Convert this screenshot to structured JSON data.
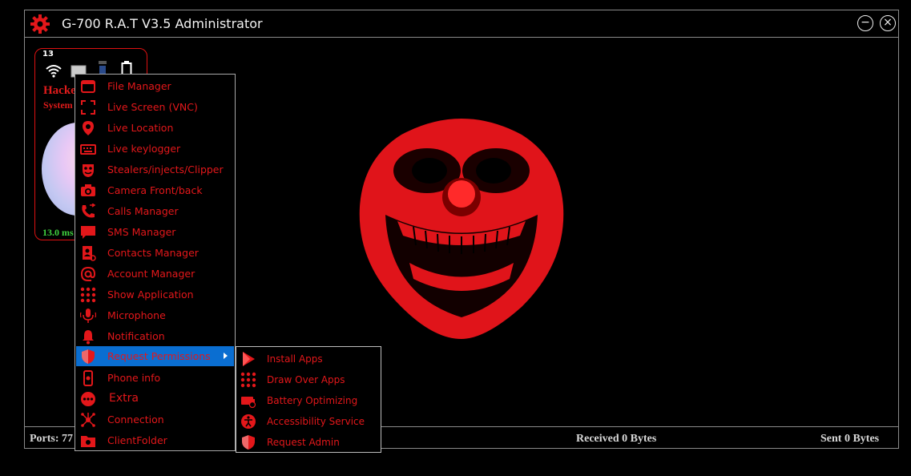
{
  "window": {
    "title": "G-700 R.A.T V3.5 Administrator",
    "minimize_glyph": "−",
    "close_glyph": "×"
  },
  "client": {
    "number": "13",
    "name": "Hacke",
    "system": "System",
    "ping": "13.0 ms"
  },
  "context_menu": {
    "items": [
      {
        "label": "File Manager",
        "icon": "file-manager-icon"
      },
      {
        "label": "Live Screen (VNC)",
        "icon": "fullscreen-icon"
      },
      {
        "label": "Live Location",
        "icon": "location-pin-icon"
      },
      {
        "label": "Live keylogger",
        "icon": "keyboard-icon"
      },
      {
        "label": "Stealers/injects/Clipper",
        "icon": "mask-icon"
      },
      {
        "label": "Camera  Front/back",
        "icon": "camera-icon"
      },
      {
        "label": "Calls Manager",
        "icon": "phone-call-icon"
      },
      {
        "label": "SMS Manager",
        "icon": "sms-icon"
      },
      {
        "label": "Contacts Manager",
        "icon": "contacts-icon"
      },
      {
        "label": "Account Manager",
        "icon": "at-sign-icon"
      },
      {
        "label": "Show Application",
        "icon": "app-grid-icon"
      },
      {
        "label": "Microphone",
        "icon": "microphone-icon"
      },
      {
        "label": "Notification",
        "icon": "bell-icon"
      },
      {
        "label": "Request Permissions",
        "icon": "shield-icon"
      },
      {
        "label": "Phone info",
        "icon": "phone-info-icon"
      },
      {
        "label": "Extra",
        "icon": "more-icon"
      },
      {
        "label": "Connection",
        "icon": "connection-icon"
      },
      {
        "label": "ClientFolder",
        "icon": "folder-icon"
      }
    ],
    "selected": "Request Permissions"
  },
  "submenu": {
    "items": [
      {
        "label": "Install Apps",
        "icon": "play-store-icon"
      },
      {
        "label": "Draw Over Apps",
        "icon": "app-grid-icon"
      },
      {
        "label": "Battery Optimizing",
        "icon": "battery-icon"
      },
      {
        "label": "Accessibility Service",
        "icon": "accessibility-icon"
      },
      {
        "label": "Request Admin",
        "icon": "shield-icon"
      }
    ]
  },
  "status": {
    "ports": "Ports: 77",
    "received": "Received 0 Bytes",
    "sent": "Sent 0 Bytes"
  },
  "colors": {
    "accent": "#e3171a",
    "selection": "#0a6ed1",
    "ping": "#3fd13f"
  }
}
